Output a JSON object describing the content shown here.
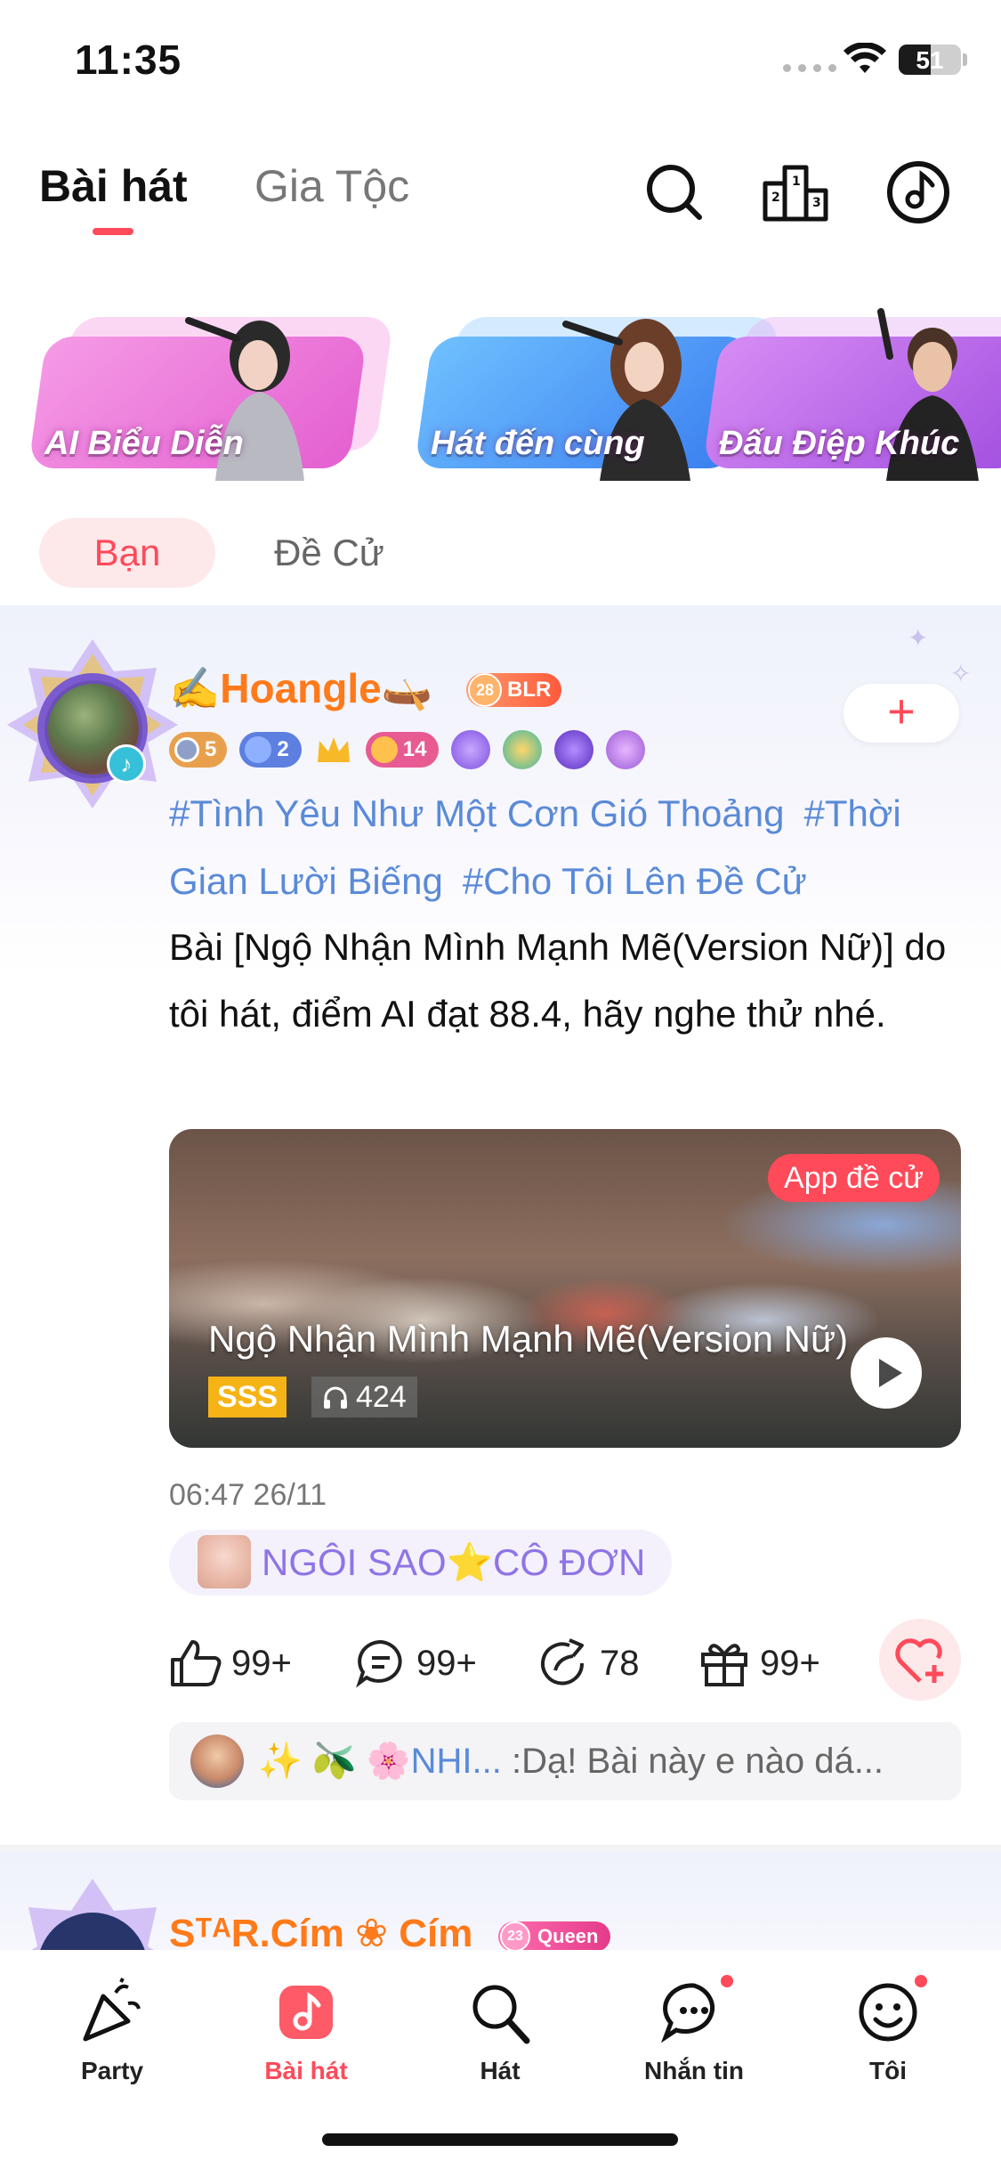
{
  "status_bar": {
    "time": "11:35",
    "battery": "51",
    "battery_level": 0.51
  },
  "top_tabs": {
    "active": "Bài hát",
    "inactive": "Gia Tộc"
  },
  "top_icons": [
    "search-icon",
    "ranking-icon",
    "music-disc-icon"
  ],
  "banners": [
    {
      "label": "AI Biểu Diễn",
      "color": "#f07ad8"
    },
    {
      "label": "Hát đến cùng",
      "color": "#4aa8ff"
    },
    {
      "label": "Đấu Điệp Khúc",
      "color": "#c66cf2"
    }
  ],
  "filters": {
    "active": "Bạn",
    "inactive": "Đề Cử"
  },
  "post": {
    "username_prefix": "✍️",
    "username": "Hoangle",
    "username_suffix": "🛶",
    "level_number": "28",
    "level_label": "BLR",
    "follow": "+",
    "badges": [
      "5",
      "2",
      "14"
    ],
    "tags": [
      "#Tình Yêu Như Một Cơn Gió Thoảng",
      "#Thời Gian Lười Biếng",
      "#Cho Tôi Lên Đề Cử"
    ],
    "description": "Bài [Ngộ Nhận Mình Mạnh Mẽ(Version Nữ)] do tôi hát, điểm AI đạt 88.4, hãy nghe thử nhé.",
    "video": {
      "badge": "App đề cử",
      "title": "Ngộ Nhận Mình Mạnh Mẽ(Version Nữ)",
      "grade": "SSS",
      "listens": "424"
    },
    "timestamp": "06:47 26/11",
    "group": "NGÔI SAO⭐CÔ ĐƠN",
    "actions": {
      "likes": "99+",
      "comments": "99+",
      "shares": "78",
      "gifts": "99+"
    },
    "comment": {
      "name": "✨ 🫒 🌸NHI...",
      "text": " :Dạ! Bài này  e nào  dá..."
    }
  },
  "next_post": {
    "username": "SᵀᴬR.Cím ❀ Cím",
    "level_number": "23",
    "level_label": "Queen"
  },
  "bottom_nav": [
    {
      "label": "Party",
      "icon": "party-popper-icon"
    },
    {
      "label": "Bài hát",
      "icon": "music-note-icon",
      "active": true
    },
    {
      "label": "Hát",
      "icon": "microphone-icon"
    },
    {
      "label": "Nhắn tin",
      "icon": "chat-bubble-icon",
      "dot": true
    },
    {
      "label": "Tôi",
      "icon": "smiley-face-icon",
      "dot": true
    }
  ],
  "colors": {
    "accent": "#ff4a5a",
    "tag": "#5a8ad8",
    "username": "#ff7a1a",
    "group": "#8f74e6"
  }
}
